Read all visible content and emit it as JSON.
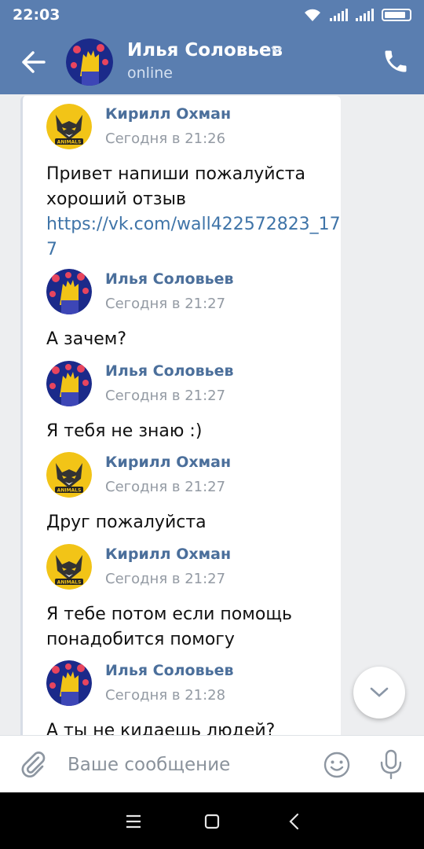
{
  "status_bar": {
    "time": "22:03"
  },
  "header": {
    "contact_name": "Илья Соловьев",
    "presence": "online"
  },
  "messages": [
    {
      "author": "Кирилл Охман",
      "time": "Сегодня в 21:26",
      "avatar": "wolf-avatar",
      "text": "Привет напиши пожалуйста хороший отзыв",
      "link": "https://vk.com/wall422572823_177"
    },
    {
      "author": "Илья Соловьев",
      "time": "Сегодня в 21:27",
      "avatar": "bart-avatar",
      "text": "А зачем?"
    },
    {
      "author": "Илья Соловьев",
      "time": "Сегодня в 21:27",
      "avatar": "bart-avatar",
      "text": "Я тебя не знаю :)"
    },
    {
      "author": "Кирилл Охман",
      "time": "Сегодня в 21:27",
      "avatar": "wolf-avatar",
      "text": "Друг пожалуйста"
    },
    {
      "author": "Кирилл Охман",
      "time": "Сегодня в 21:27",
      "avatar": "wolf-avatar",
      "text": "Я тебе потом если помощь понадобится помогу"
    },
    {
      "author": "Илья Соловьев",
      "time": "Сегодня в 21:28",
      "avatar": "bart-avatar",
      "text": "А ты не кидаешь людей?"
    }
  ],
  "wolf_avatar_caption": "ANIMALS",
  "composer": {
    "placeholder": "Ваше сообщение"
  },
  "icons": [
    "back-arrow-icon",
    "chevron-down-icon",
    "phone-icon",
    "scroll-down-icon",
    "paperclip-icon",
    "emoji-icon",
    "microphone-icon",
    "menu-icon",
    "home-icon",
    "back-icon"
  ],
  "colors": {
    "header": "#5a7eb0",
    "author": "#4b6f9b",
    "link": "#3f74a8",
    "background": "#edeef0"
  }
}
